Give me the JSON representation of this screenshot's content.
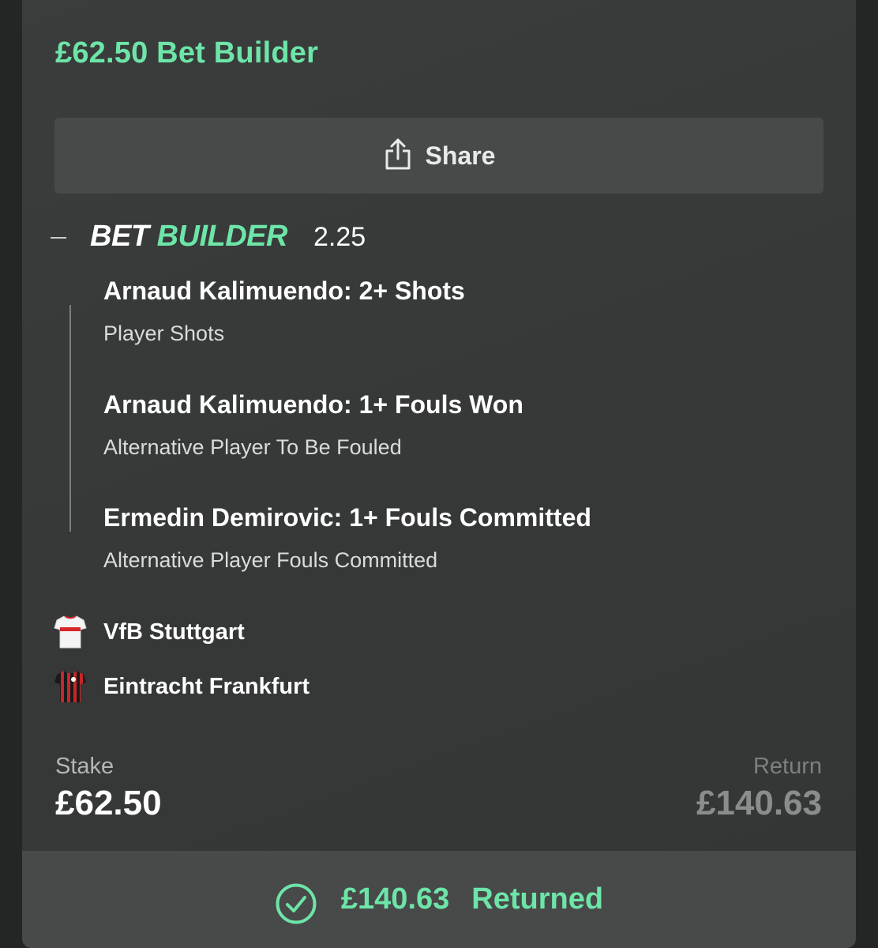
{
  "header": {
    "title": "£62.50 Bet Builder"
  },
  "share": {
    "label": "Share",
    "icon": "share-icon"
  },
  "bet_builder": {
    "logo_word_1": "BET",
    "logo_word_2": "BUILDER",
    "odds": "2.25",
    "legs": [
      {
        "selection": "Arnaud Kalimuendo: 2+ Shots",
        "market": "Player Shots"
      },
      {
        "selection": "Arnaud Kalimuendo: 1+ Fouls Won",
        "market": "Alternative Player To Be Fouled"
      },
      {
        "selection": "Ermedin Demirovic: 1+ Fouls Committed",
        "market": "Alternative Player Fouls Committed"
      }
    ]
  },
  "teams": [
    {
      "name": "VfB Stuttgart",
      "icon": "white-red-kit-icon"
    },
    {
      "name": "Eintracht Frankfurt",
      "icon": "black-red-striped-kit-icon"
    }
  ],
  "summary": {
    "stake_label": "Stake",
    "stake_value": "£62.50",
    "return_label": "Return",
    "return_value": "£140.63"
  },
  "footer": {
    "amount": "£140.63",
    "status": "Returned",
    "icon": "check-circle-icon"
  },
  "colors": {
    "accent": "#6ee5a8",
    "card_bg": "#383b3a",
    "button_bg": "#474a49"
  }
}
